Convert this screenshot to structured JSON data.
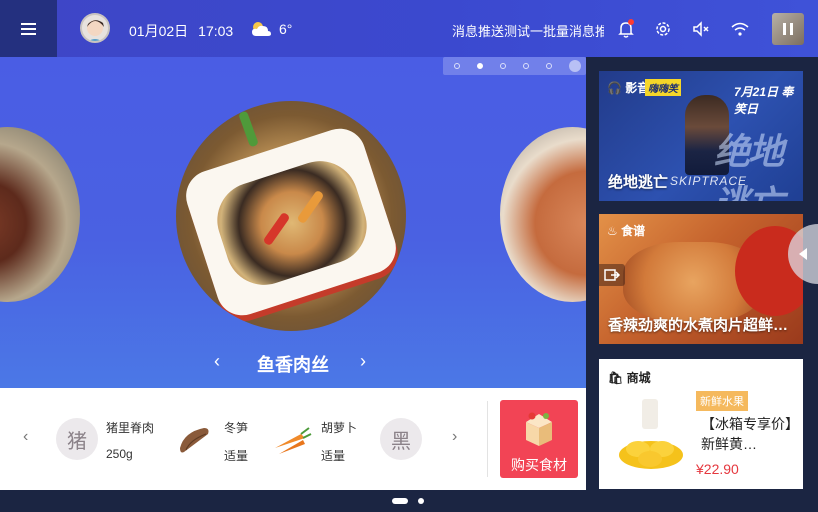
{
  "topbar": {
    "date": "01月02日",
    "time": "17:03",
    "weather_icon": "cloud-sun-icon",
    "temperature": "6°",
    "marquee": "消息推送测试一批量消息推",
    "icons": [
      "bell-icon",
      "gear-icon",
      "mute-icon",
      "wifi-icon"
    ]
  },
  "hero": {
    "carousel_dots": 6,
    "active_dot": 1,
    "dish_title": "鱼香肉丝",
    "prev_glyph": "‹",
    "next_glyph": "›"
  },
  "ingredients": {
    "prev_glyph": "‹",
    "next_glyph": "›",
    "items": [
      {
        "icon": "猪",
        "name": "猪里脊肉",
        "qty": "250g"
      },
      {
        "icon": "yam-icon",
        "name": "冬笋",
        "qty": "适量"
      },
      {
        "icon": "carrot-icon",
        "name": "胡萝卜",
        "qty": "适量"
      },
      {
        "icon": "黑"
      }
    ]
  },
  "buy": {
    "label": "购买食材"
  },
  "side": {
    "movie": {
      "tag": "影音",
      "logo": "嗨嗨笑",
      "date": "7月21日 奉笑日",
      "caption": "绝地逃亡",
      "subtitle": "SKIPTRACE",
      "big_text": "绝地逃亡"
    },
    "food": {
      "tag": "食谱",
      "caption": "香辣劲爽的水煮肉片超鲜…"
    },
    "shop": {
      "tag": "商城",
      "badge": "新鲜水果",
      "title": "【冰箱专享价】新鲜黄…",
      "price": "¥22.90"
    }
  },
  "pager": {
    "pages": 2,
    "active": 0
  },
  "colors": {
    "topbar": "#3e46c6",
    "hero": "#4a5de4",
    "buy": "#f24455",
    "price": "#e5383f",
    "badge": "#f5b95d",
    "panel": "#1b2542"
  }
}
